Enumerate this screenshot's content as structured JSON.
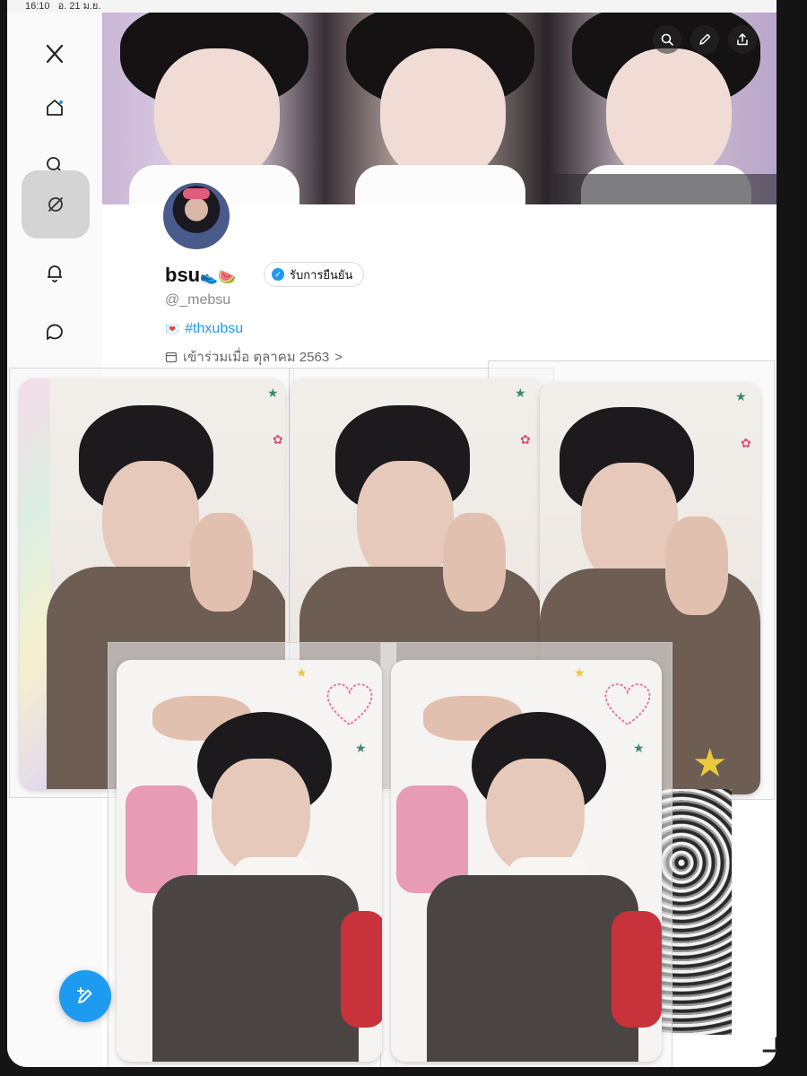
{
  "status_bar": {
    "time": "16:10",
    "date": "อ. 21 ม.ย."
  },
  "nav": [
    {
      "name": "x-logo-icon",
      "glyph": "X"
    },
    {
      "name": "home-icon"
    },
    {
      "name": "search-icon"
    },
    {
      "name": "grok-icon",
      "active": true
    },
    {
      "name": "notifications-icon"
    },
    {
      "name": "messages-icon"
    }
  ],
  "header_actions": [
    "search-icon",
    "edit-icon",
    "share-icon"
  ],
  "profile": {
    "display_name": "bsu",
    "name_emoji": "👟🍉",
    "verify_label": "รับการยืนยัน",
    "handle": "@_mebsu",
    "bio_emoji": "💌",
    "bio_hashtag": "#thxubsu",
    "joined": "เข้าร่วมเมื่อ ตุลาคม 2563",
    "joined_chevron": ">"
  },
  "colors": {
    "accent": "#1d9bf0",
    "background": "#ffffff",
    "sidebar": "#fafafa"
  }
}
